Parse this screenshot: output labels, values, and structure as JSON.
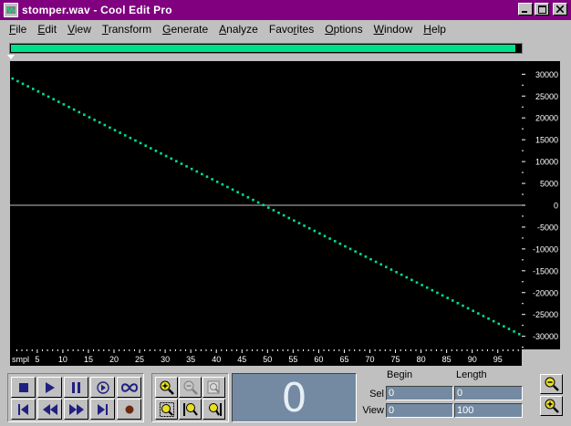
{
  "window": {
    "title": "stomper.wav - Cool Edit Pro",
    "minimize_icon": "minimize-icon",
    "maximize_icon": "maximize-icon",
    "close_icon": "close-icon"
  },
  "menu": {
    "items": [
      {
        "pre": "",
        "u": "F",
        "post": "ile"
      },
      {
        "pre": "",
        "u": "E",
        "post": "dit"
      },
      {
        "pre": "",
        "u": "V",
        "post": "iew"
      },
      {
        "pre": "",
        "u": "T",
        "post": "ransform"
      },
      {
        "pre": "",
        "u": "G",
        "post": "enerate"
      },
      {
        "pre": "",
        "u": "A",
        "post": "nalyze"
      },
      {
        "pre": "Favo",
        "u": "r",
        "post": "ites"
      },
      {
        "pre": "",
        "u": "O",
        "post": "ptions"
      },
      {
        "pre": "",
        "u": "W",
        "post": "indow"
      },
      {
        "pre": "",
        "u": "H",
        "post": "elp"
      }
    ]
  },
  "overview": {
    "fill_fraction": 0.99,
    "color": "#00e08a"
  },
  "waveform": {
    "color": "#00e08a",
    "centerline_color": "#c0c0c0",
    "samples_start": 0,
    "samples_end": 100,
    "value_start": 29000,
    "value_end": -29500,
    "y_ticks": [
      "30000",
      "25000",
      "20000",
      "15000",
      "10000",
      "5000",
      "0",
      "-5000",
      "-10000",
      "-15000",
      "-20000",
      "-25000",
      "-30000"
    ],
    "x_unit": "smpl",
    "x_ticks": [
      "5",
      "10",
      "15",
      "20",
      "25",
      "30",
      "35",
      "40",
      "45",
      "50",
      "55",
      "60",
      "65",
      "70",
      "75",
      "80",
      "85",
      "90",
      "95"
    ]
  },
  "transport": {
    "stop": "stop-icon",
    "play": "play-icon",
    "pause": "pause-icon",
    "play_to_end": "play-to-end-icon",
    "loop": "loop-icon",
    "go_start": "go-to-start-icon",
    "rewind": "rewind-icon",
    "fast_forward": "fast-forward-icon",
    "go_end": "go-to-end-icon",
    "record": "record-icon"
  },
  "time_display": "0",
  "selection": {
    "begin_header": "Begin",
    "length_header": "Length",
    "sel_label": "Sel",
    "view_label": "View",
    "sel_begin": "0",
    "sel_length": "0",
    "view_begin": "0",
    "view_length": "100"
  }
}
